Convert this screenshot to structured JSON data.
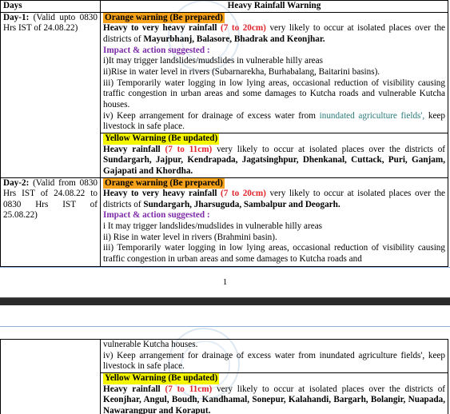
{
  "table": {
    "header": {
      "days": "Days",
      "warning": "Heavy Rainfall Warning"
    }
  },
  "day1": {
    "label": "Day-1:",
    "validity": "(Valid upto 0830 Hrs IST of 24.08.22)",
    "orange": {
      "tag": "Orange warning (Be prepared)",
      "lead": "Heavy to very heavy rainfall",
      "amount": "(7 to 20cm)",
      "text": "very likely to occur at isolated places over the districts of",
      "districts": "Mayurbhanj, Balasore, Bhadrak and Keonjhar.",
      "impact_title": "Impact & action suggested :",
      "impacts": [
        "i)It may trigger landslides/mudslides in vulnerable hilly areas",
        "ii)Rise in water level in rivers (Subarnarekha, Burhabalang, Baitarini basins).",
        "iii) Temporarily water logging in low lying areas, occasional reduction of visibility causing traffic congestion in urban areas and some damages to Kutcha roads and vulnerable Kutcha houses."
      ],
      "impact4_pre": "iv) Keep arrangement for drainage of excess water from",
      "impact4_teal": "inundated agriculture fields',",
      "impact4_post": "keep livestock in safe place."
    },
    "yellow": {
      "tag": "Yellow Warning (Be updated)",
      "lead": "Heavy rainfall",
      "amount": "(7 to 11cm)",
      "text": "very likely to occur at isolated places over the districts of",
      "districts": "Sundargarh, Jajpur, Kendrapada, Jagatsinghpur, Dhenkanal, Cuttack, Puri, Ganjam, Gajapati and Khordha."
    }
  },
  "day2": {
    "label": "Day-2:",
    "validity": "(Valid from 0830 Hrs IST of 24.08.22 to 0830 Hrs IST of 25.08.22)",
    "orange": {
      "tag": "Orange warning (Be prepared)",
      "lead": "Heavy to very heavy rainfall",
      "amount": "(7 to 20cm)",
      "text": "very likely to occur at isolated places over the districts of",
      "districts": "Sundargarh, Jharsuguda, Sambalpur and Deogarh.",
      "impact_title": "Impact & action suggested :",
      "impacts": [
        "i It may trigger landslides/mudslides in vulnerable hilly areas",
        "ii) Rise in water level in rivers (Brahmini basin).",
        "iii) Temporarily water logging in low lying areas, occasional reduction of visibility causing traffic congestion in urban areas and some damages to Kutcha roads and"
      ]
    }
  },
  "page_number": "1",
  "page2": {
    "continued": "vulnerable Kutcha houses.",
    "impact4_pre": "iv) Keep arrangement for drainage of excess water from inundated agriculture fields',",
    "impact4_post": "keep livestock in safe place.",
    "yellow": {
      "tag": "Yellow Warning (Be updated)",
      "lead": "Heavy rainfall",
      "amount": "(7 to 11cm)",
      "text": "very likely to occur at isolated places over the districts of",
      "districts": "Keonjhar, Angul, Boudh, Kandhamal, Sonepur, Kalahandi, Bargarh, Bolangir, Nuapada, Nawarangpur and Koraput."
    }
  }
}
